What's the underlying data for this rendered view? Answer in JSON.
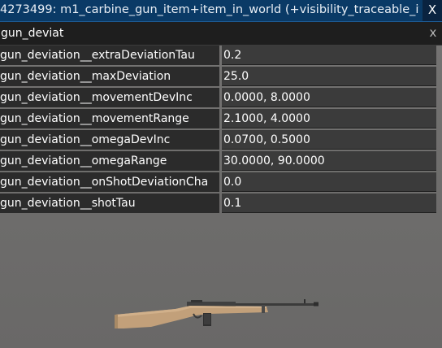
{
  "window": {
    "title": "4273499: m1_carbine_gun_item+item_in_world (+visibility_traceable_ite",
    "close_label": "X"
  },
  "filter": {
    "value": "gun_deviat",
    "clear_label": "x"
  },
  "properties": [
    {
      "name": "gun_deviation__extraDeviationTau",
      "value": "0.2"
    },
    {
      "name": "gun_deviation__maxDeviation",
      "value": "25.0"
    },
    {
      "name": "gun_deviation__movementDevInc",
      "value": "0.0000, 8.0000"
    },
    {
      "name": "gun_deviation__movementRange",
      "value": "2.1000, 4.0000"
    },
    {
      "name": "gun_deviation__omegaDevInc",
      "value": "0.0700, 0.5000"
    },
    {
      "name": "gun_deviation__omegaRange",
      "value": "30.0000, 90.0000"
    },
    {
      "name": "gun_deviation__onShotDeviationCha",
      "value": "0.0"
    },
    {
      "name": "gun_deviation__shotTau",
      "value": "0.1"
    }
  ],
  "colors": {
    "title_bar": "#0a3a66",
    "name_cell": "#2b2b2b",
    "value_cell": "#3b3b3b",
    "scene_background": "#6f6e6d",
    "rifle_stock": "#c2a07a",
    "rifle_metal": "#3a3a3a"
  },
  "scene": {
    "object_icon": "m1-carbine-rifle-icon"
  }
}
